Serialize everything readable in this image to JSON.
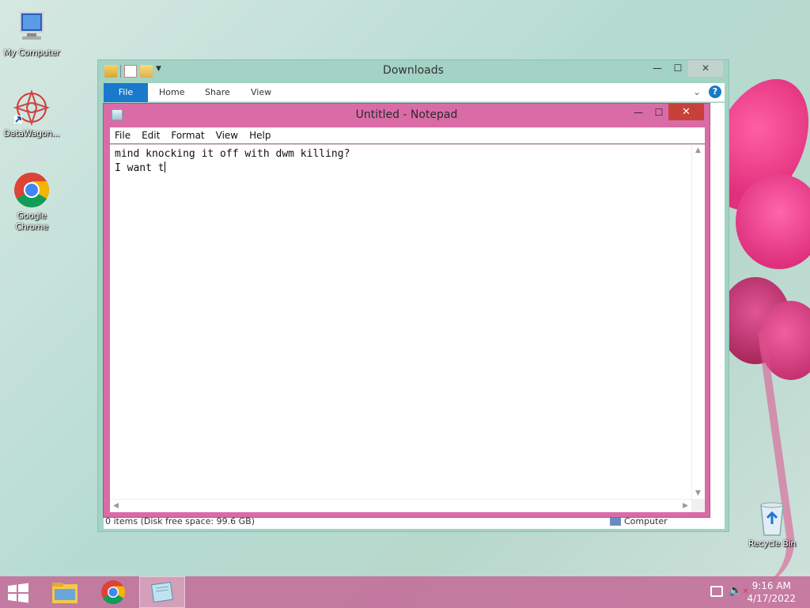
{
  "desktop": {
    "icons": [
      {
        "label": "My Computer",
        "icon": "computer-icon"
      },
      {
        "label": "DataWagon...",
        "icon": "datawagon-icon"
      },
      {
        "label": "Google Chrome",
        "icon": "chrome-icon"
      },
      {
        "label": "Recycle Bin",
        "icon": "recycle-bin-icon"
      }
    ]
  },
  "explorer": {
    "title": "Downloads",
    "tabs": [
      "File",
      "Home",
      "Share",
      "View"
    ],
    "status_left": "0 items (Disk free space: 99.6 GB)",
    "status_right": "Computer",
    "buttons": {
      "minimize": "—",
      "maximize": "☐",
      "close": "✕"
    }
  },
  "notepad": {
    "title": "Untitled - Notepad",
    "menu": [
      "File",
      "Edit",
      "Format",
      "View",
      "Help"
    ],
    "content_line1": "mind knocking it off with dwm killing?",
    "content_line2": "I want t",
    "buttons": {
      "minimize": "—",
      "maximize": "☐",
      "close": "✕"
    }
  },
  "taskbar": {
    "apps": [
      "file-explorer-icon",
      "chrome-icon",
      "notepad-icon"
    ],
    "active_app": "notepad-icon",
    "time": "9:16 AM",
    "date": "4/17/2022",
    "tray_icons": [
      "network-icon",
      "volume-muted-icon"
    ]
  },
  "colors": {
    "notepad_frame": "#d96ca7",
    "explorer_frame": "#a2d3c4",
    "file_tab": "#1979ca",
    "close_button": "#c7403a",
    "taskbar": "#c46896"
  }
}
